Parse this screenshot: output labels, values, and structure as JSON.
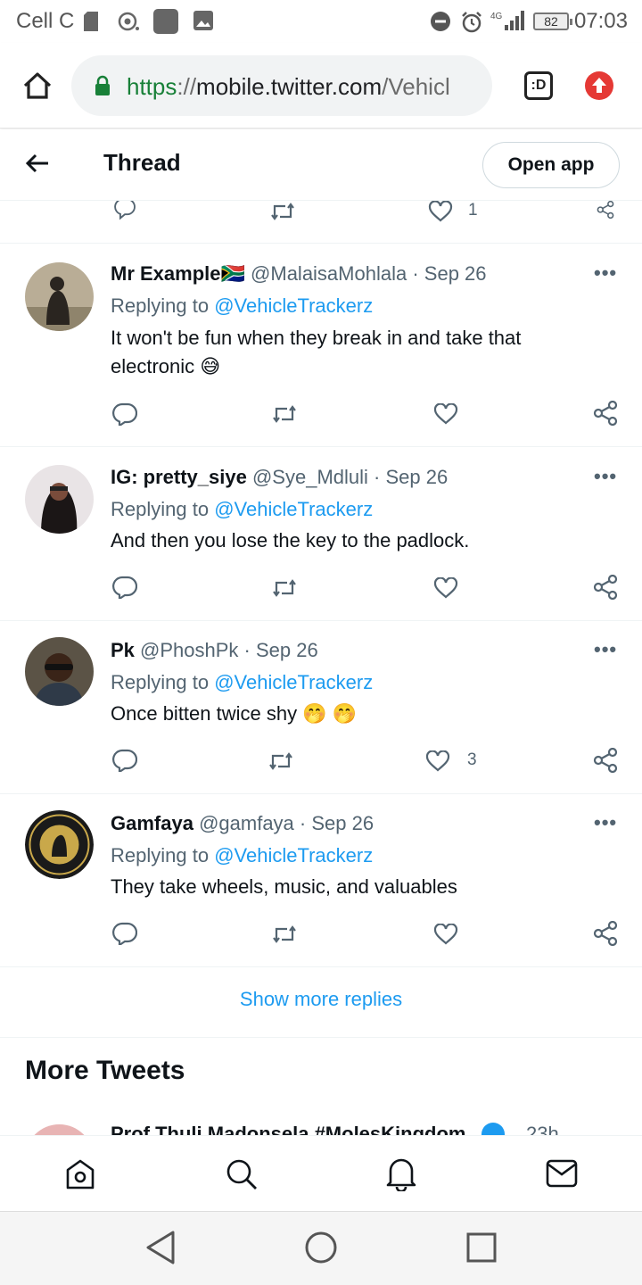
{
  "status_bar": {
    "carrier": "Cell C",
    "battery": "82",
    "time": "07:03",
    "network": "4G"
  },
  "browser": {
    "url_scheme": "https",
    "url_sep": "://",
    "url_host": "mobile.twitter.com",
    "url_path": "/Vehicl",
    "tab_count_icon": ":D"
  },
  "header": {
    "title": "Thread",
    "open_app": "Open app"
  },
  "prev_tweet_actions": {
    "like_count": "1"
  },
  "tweets": [
    {
      "name": "Mr Example",
      "flag": "🇿🇦",
      "handle": "@MalaisaMohlala",
      "sep": " · ",
      "date": "Sep 26",
      "replying_prefix": "Replying to ",
      "replying_handle": "@VehicleTrackerz",
      "text": "It won't be fun when they break in and take that electronic 😅",
      "like_count": ""
    },
    {
      "name": "IG: pretty_siye",
      "handle": "@Sye_Mdluli",
      "sep": " · ",
      "date": "Sep 26",
      "replying_prefix": "Replying to ",
      "replying_handle": "@VehicleTrackerz",
      "text": "And then you lose the key to the padlock.",
      "like_count": ""
    },
    {
      "name": "Pk",
      "handle": "@PhoshPk",
      "sep": " · ",
      "date": "Sep 26",
      "replying_prefix": "Replying to ",
      "replying_handle": "@VehicleTrackerz",
      "text": "Once bitten twice shy 🤭 🤭",
      "like_count": "3"
    },
    {
      "name": "Gamfaya",
      "handle": "@gamfaya",
      "sep": " · ",
      "date": "Sep 26",
      "replying_prefix": "Replying to ",
      "replying_handle": "@VehicleTrackerz",
      "text": "They take wheels, music, and valuables",
      "like_count": ""
    }
  ],
  "show_more_replies": "Show more replies",
  "more_tweets_heading": "More Tweets",
  "peek_tweet": {
    "name": "Prof Thuli Madonsela #MolesKingdom",
    "time": "23h"
  },
  "colors": {
    "accent": "#1d9bf0",
    "text_primary": "#0f1419",
    "text_secondary": "#536471",
    "secure_green": "#188038",
    "update_red": "#e53935"
  },
  "icons": {
    "home_browser": "house-icon",
    "lock": "lock-icon",
    "reply": "speech-bubble-icon",
    "retweet": "retweet-icon",
    "like": "heart-icon",
    "share": "share-icon",
    "nav_home": "home-icon",
    "nav_search": "search-icon",
    "nav_notifications": "bell-icon",
    "nav_messages": "envelope-icon"
  }
}
